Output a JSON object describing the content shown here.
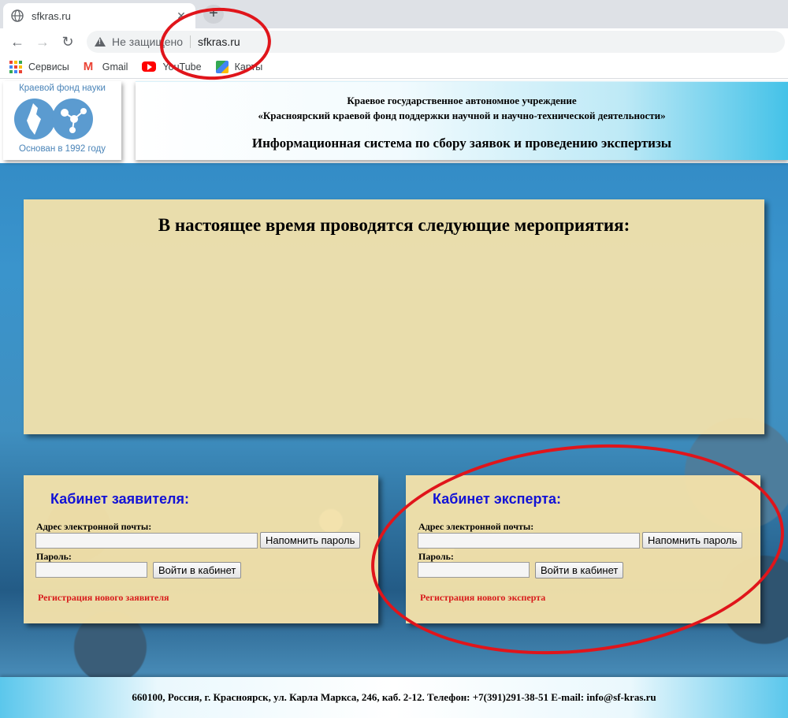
{
  "browser": {
    "tab": {
      "title": "sfkras.ru",
      "close_glyph": "✕"
    },
    "new_tab_glyph": "+",
    "nav": {
      "back_glyph": "←",
      "forward_glyph": "→",
      "reload_glyph": "↻"
    },
    "omnibox": {
      "security_status": "Не защищено",
      "url": "sfkras.ru"
    },
    "bookmarks": [
      {
        "label": "Сервисы",
        "icon": "apps-grid-icon"
      },
      {
        "label": "Gmail",
        "icon": "gmail-icon"
      },
      {
        "label": "YouTube",
        "icon": "youtube-icon"
      },
      {
        "label": "Карты",
        "icon": "maps-icon"
      }
    ]
  },
  "site": {
    "logo": {
      "top_text": "Краевой фонд науки",
      "bottom_text": "Основан в 1992 году"
    },
    "header": {
      "org_line1": "Краевое государственное автономное учреждение",
      "org_line2": "«Красноярский краевой фонд поддержки научной и научно-технической деятельности»",
      "system_title": "Информационная система по сбору заявок и проведению экспертизы"
    },
    "events": {
      "title": "В настоящее время проводятся следующие мероприятия:"
    },
    "applicant_cabinet": {
      "title": "Кабинет заявителя:",
      "email_label": "Адрес электронной почты:",
      "email_value": "",
      "password_label": "Пароль:",
      "password_value": "",
      "remind_button": "Напомнить пароль",
      "login_button": "Войти в кабинет",
      "register_link": "Регистрация нового заявителя"
    },
    "expert_cabinet": {
      "title": "Кабинет эксперта:",
      "email_label": "Адрес электронной почты:",
      "email_value": "",
      "password_label": "Пароль:",
      "password_value": "",
      "remind_button": "Напомнить пароль",
      "login_button": "Войти в кабинет",
      "register_link": "Регистрация нового эксперта"
    },
    "footer": {
      "text": "660100, Россия, г. Красноярск, ул. Карла Маркса, 246, каб. 2-12. Телефон: +7(391)291-38-51 E-mail: info@sf-kras.ru"
    }
  },
  "colors": {
    "panel_bg": "#f6e3aa",
    "cabinet_title": "#1212d6",
    "register_link": "#d81b1b",
    "annotation": "#e0151b"
  }
}
